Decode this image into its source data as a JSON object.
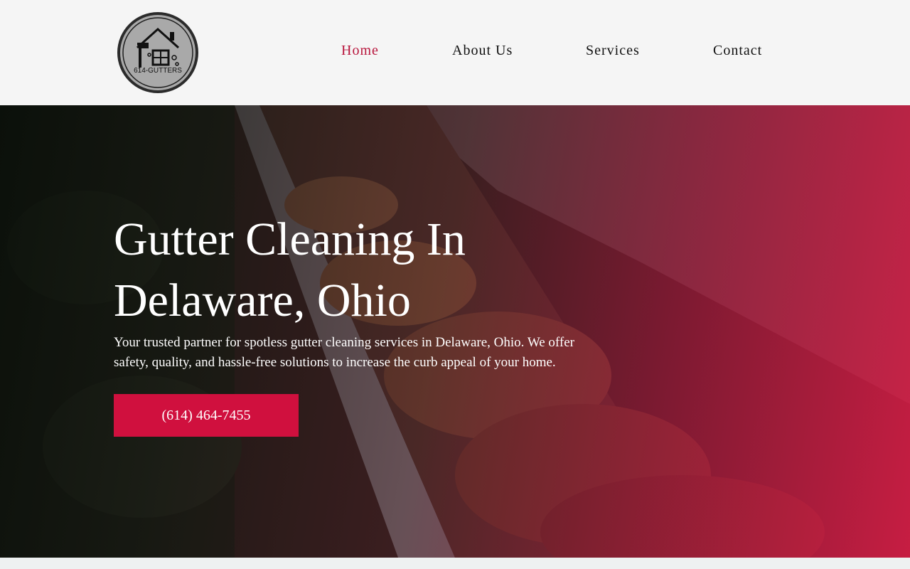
{
  "header": {
    "logo_text": "614-GUTTERS",
    "nav": [
      {
        "label": "Home",
        "active": true
      },
      {
        "label": "About Us",
        "active": false
      },
      {
        "label": "Services",
        "active": false
      },
      {
        "label": "Contact",
        "active": false
      }
    ]
  },
  "hero": {
    "title_line1": "Gutter Cleaning In",
    "title_line2": "Delaware, Ohio",
    "description": "Your trusted partner for spotless gutter cleaning services in Delaware, Ohio. We offer safety, quality, and hassle-free solutions to increase the curb appeal of your home.",
    "cta_label": "(614) 464-7455"
  },
  "colors": {
    "accent": "#d0103e",
    "nav_active": "#b8163d",
    "header_bg": "#f5f5f5"
  },
  "icons": {
    "logo": "house-gutter-logo"
  }
}
